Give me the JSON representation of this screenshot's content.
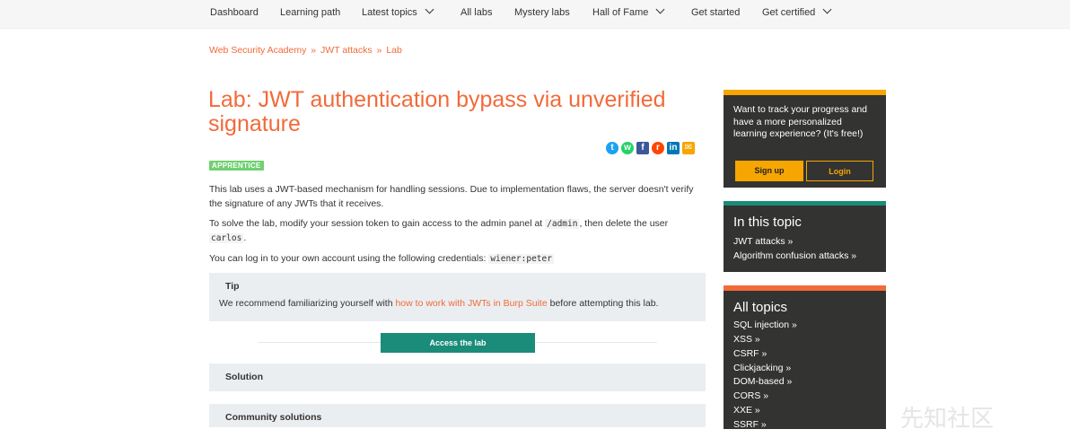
{
  "nav": {
    "items": [
      "Dashboard",
      "Learning path",
      "Latest topics",
      "All labs",
      "Mystery labs",
      "Hall of Fame",
      "Get started",
      "Get certified"
    ]
  },
  "breadcrumb": [
    "Web Security Academy",
    "JWT attacks",
    "Lab"
  ],
  "breadcrumb_separator": "»",
  "title": "Lab: JWT authentication bypass via unverified signature",
  "share_icons": [
    "twitter-icon",
    "whatsapp-icon",
    "facebook-icon",
    "reddit-icon",
    "linkedin-icon",
    "email-icon"
  ],
  "badge": "APPRENTICE",
  "intro": "This lab uses a JWT-based mechanism for handling sessions. Due to implementation flaws, the server doesn't verify the signature of any JWTs that it receives.",
  "task": {
    "before": "To solve the lab, modify your session token to gain access to the admin panel at",
    "path": "/admin",
    "middle": ", then delete the user",
    "user": "carlos",
    "after": "."
  },
  "login": {
    "text": "You can log in to your own account using the following credentials:",
    "credentials": "wiener:peter"
  },
  "tip": {
    "title": "Tip",
    "before": "We recommend familiarizing yourself with",
    "link": "how to work with JWTs in Burp Suite",
    "after": "before attempting this lab."
  },
  "access_button": "Access the lab",
  "solution_label": "Solution",
  "community_label": "Community solutions",
  "cta": {
    "text": "Want to track your progress and have a more personalized learning experience? (It's free!)",
    "signup": "Sign up",
    "login": "Login"
  },
  "in_topic": {
    "title": "In this topic",
    "links": [
      "JWT attacks »",
      "Algorithm confusion attacks »"
    ]
  },
  "all_topics": {
    "title": "All topics",
    "links": [
      "SQL injection »",
      "XSS »",
      "CSRF »",
      "Clickjacking »",
      "DOM-based »",
      "CORS »",
      "XXE »",
      "SSRF »"
    ]
  },
  "watermark": "先知社区",
  "colors": {
    "accent": "#f26a3a",
    "cta_top": "#f7a500",
    "topic_top": "#1a8c79",
    "all_top": "#f26a3a",
    "button_green": "#1a8c79",
    "signup_bg": "#f7a500"
  }
}
